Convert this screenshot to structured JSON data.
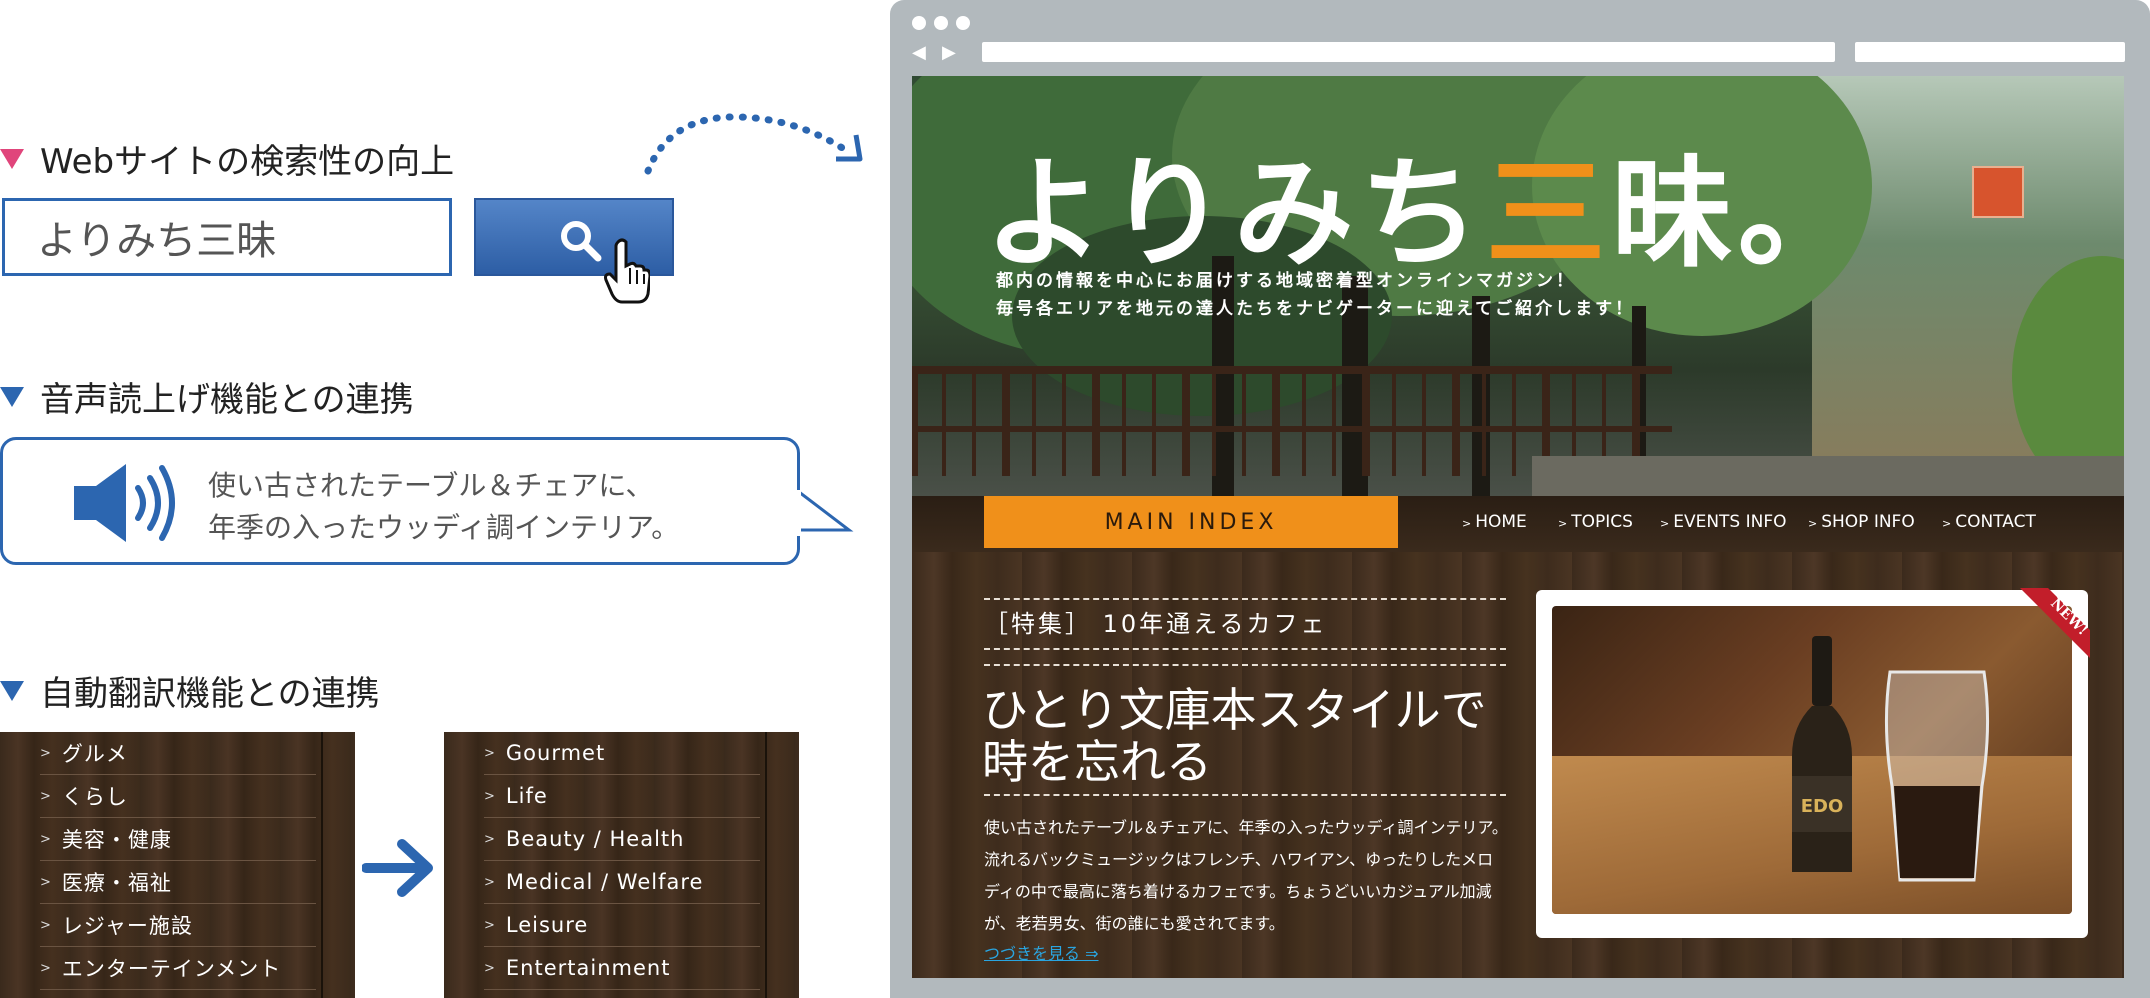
{
  "features": {
    "search": {
      "heading": "Webサイトの検索性の向上",
      "input_value": "よりみち三昧"
    },
    "speech": {
      "heading": "音声読上げ機能との連携",
      "bubble_lines": [
        "使い古されたテーブル＆チェアに、",
        "年季の入ったウッディ調インテリア。"
      ]
    },
    "translate": {
      "heading": "自動翻訳機能との連携",
      "menu_ja": [
        "グルメ",
        "くらし",
        "美容・健康",
        "医療・福祉",
        "レジャー施設",
        "エンターテインメント"
      ],
      "menu_en": [
        "Gourmet",
        "Life",
        "Beauty / Health",
        "Medical / Welfare",
        "Leisure",
        "Entertainment"
      ]
    }
  },
  "site": {
    "logo": {
      "before": "よりみち",
      "accent": "三",
      "after": "昧。"
    },
    "tagline": [
      "都内の情報を中心にお届けする地域密着型オンラインマガジン！",
      "毎号各エリアを地元の達人たちをナビゲーターに迎えてご紹介します！"
    ],
    "main_index": "MAIN INDEX",
    "nav": [
      "HOME",
      "TOPICS",
      "EVENTS INFO",
      "SHOP INFO",
      "CONTACT"
    ],
    "article": {
      "label": "［特集］ 10年通えるカフェ",
      "title_lines": [
        "ひとり文庫本スタイルで",
        "時を忘れる"
      ],
      "body_lines": [
        "使い古されたテーブル＆チェアに、年季の入ったウッディ調インテリア。",
        "流れるバックミュージックはフレンチ、ハワイアン、ゆったりしたメロ",
        "ディの中で最高に落ち着けるカフェです。ちょうどいいカジュアル加減",
        "が、老若男女、街の誰にも愛されてます。"
      ],
      "more_link": "つづきを見る ⇒",
      "ribbon": "NEW!",
      "bottle_label": "EDO"
    }
  },
  "colors": {
    "blue_accent": "#2c66b0",
    "pink_accent": "#e0457b",
    "orange_accent": "#f0901a",
    "link_blue": "#2aa5e0"
  },
  "icons": [
    "magnifier-icon",
    "hand-cursor-icon",
    "speaker-icon",
    "arrow-right-icon",
    "dotted-curve-arrow-icon"
  ]
}
